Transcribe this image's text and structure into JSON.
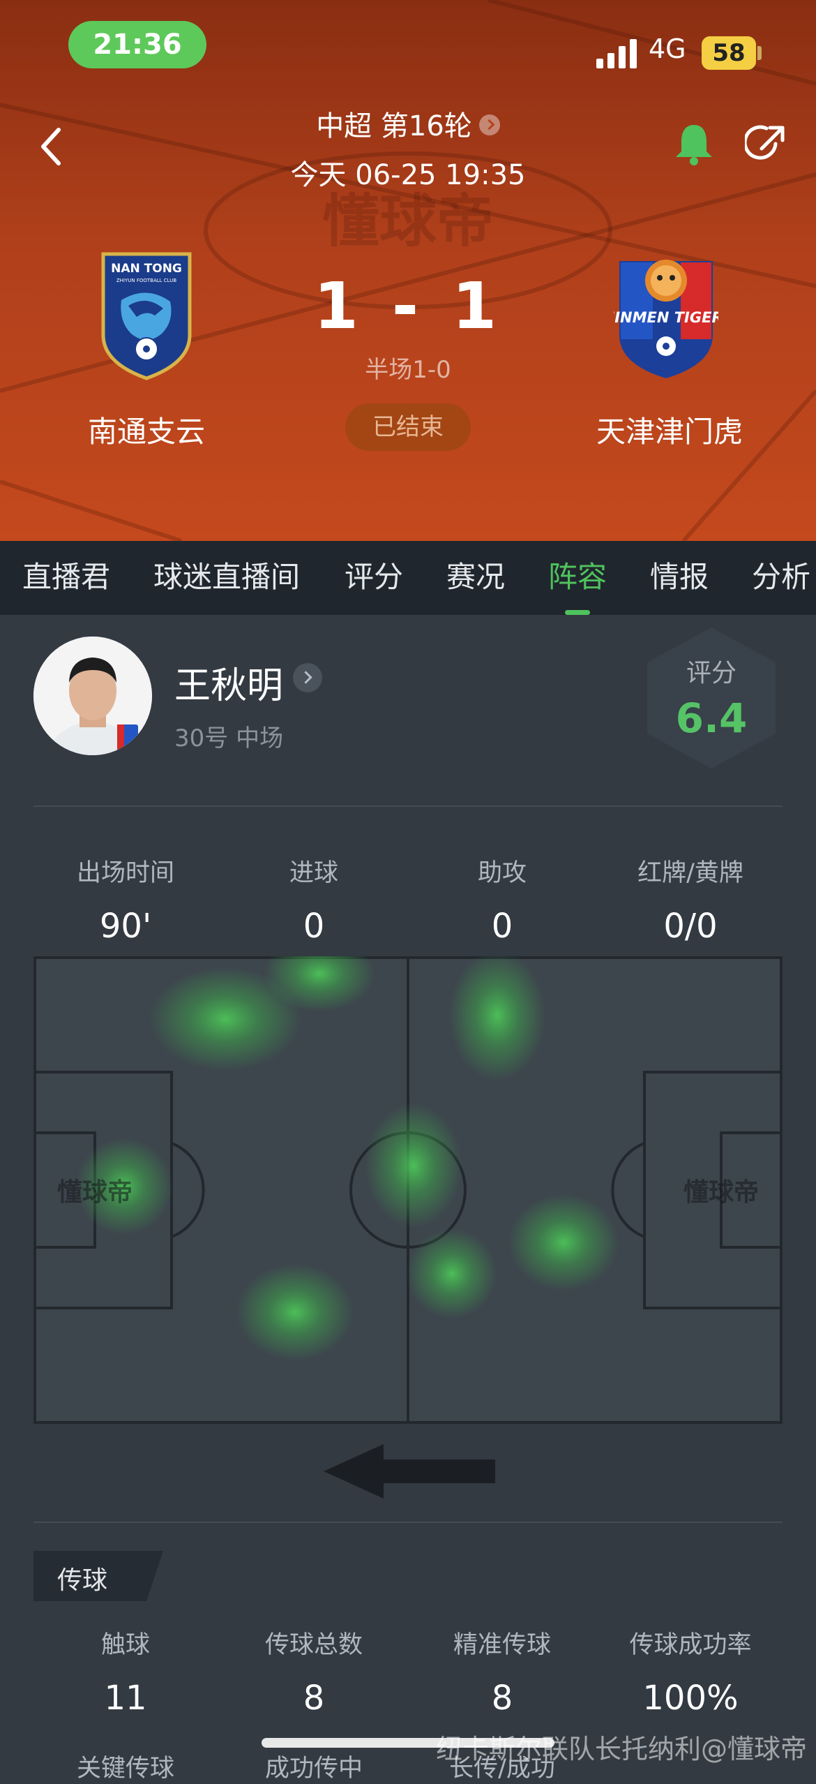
{
  "status_bar": {
    "time": "21:36",
    "network": "4G",
    "battery": "58"
  },
  "match": {
    "league_round": "中超 第16轮",
    "datetime": "今天 06-25 19:35",
    "home_team": "南通支云",
    "away_team": "天津津门虎",
    "home_score": "1",
    "away_score": "1",
    "score_separator": "-",
    "half_time": "半场1-0",
    "status": "已结束"
  },
  "tabs": [
    {
      "label": "直播君"
    },
    {
      "label": "球迷直播间"
    },
    {
      "label": "评分"
    },
    {
      "label": "赛况"
    },
    {
      "label": "阵容",
      "active": true
    },
    {
      "label": "情报"
    },
    {
      "label": "分析"
    }
  ],
  "player": {
    "name": "王秋明",
    "info": "30号 中场",
    "rating_label": "评分",
    "rating": "6.4"
  },
  "summary_stats": [
    {
      "label": "出场时间",
      "value": "90'"
    },
    {
      "label": "进球",
      "value": "0"
    },
    {
      "label": "助攻",
      "value": "0"
    },
    {
      "label": "红牌/黄牌",
      "value": "0/0"
    }
  ],
  "pitch_watermark": "懂球帝",
  "hero_watermark": "懂球帝",
  "passes": {
    "section_label": "传球",
    "stats": [
      {
        "label": "触球",
        "value": "11"
      },
      {
        "label": "传球总数",
        "value": "8"
      },
      {
        "label": "精准传球",
        "value": "8"
      },
      {
        "label": "传球成功率",
        "value": "100%"
      }
    ],
    "next_row_labels": [
      "关键传球",
      "成功传中",
      "长传/成功"
    ]
  },
  "overlay_watermark": "纽卡斯尔联队长托纳利@懂球帝",
  "colors": {
    "accent": "#4fc35d",
    "hero": "#c4491d"
  }
}
